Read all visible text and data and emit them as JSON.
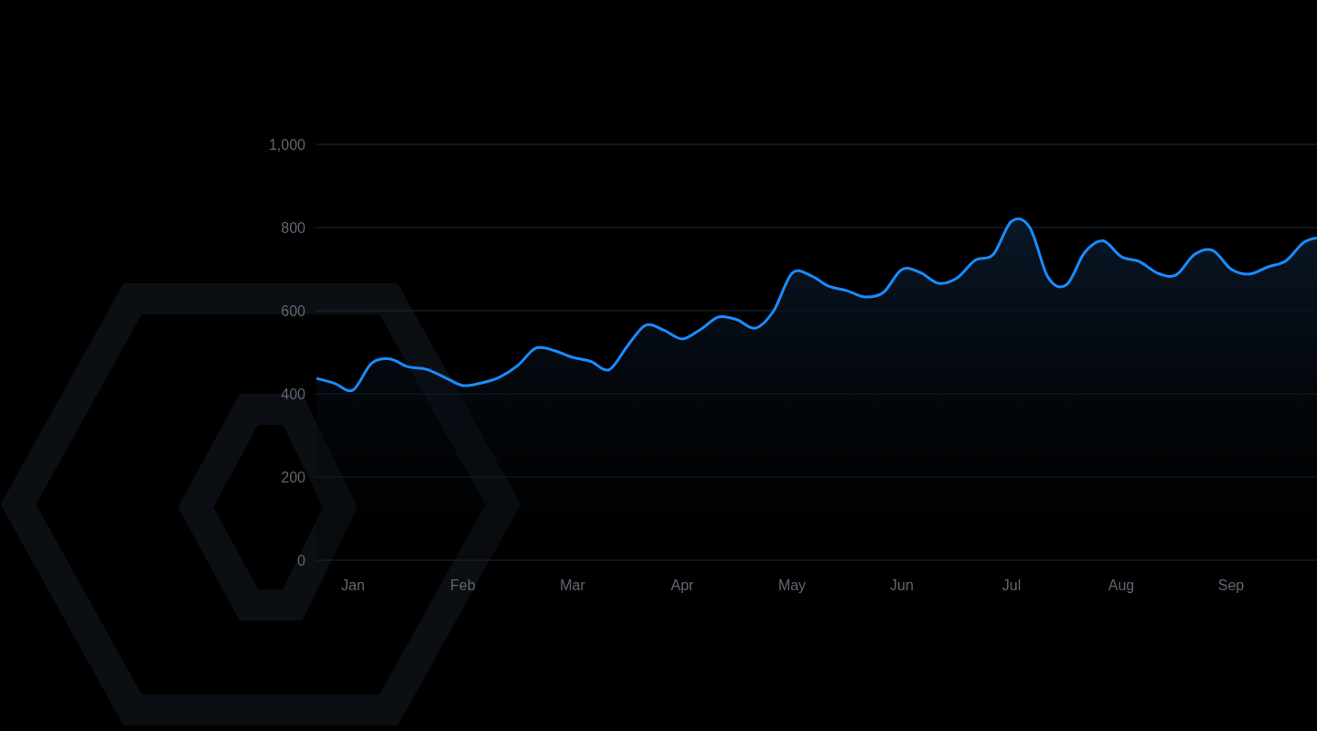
{
  "chart": {
    "chart_data": {
      "type": "area",
      "grid": true,
      "ylim": [
        0,
        1000
      ],
      "yticks": [
        0,
        200,
        400,
        600,
        800,
        {
          "value": 1000,
          "label": "1,000"
        }
      ],
      "categories": [
        null,
        null,
        "Jan",
        null,
        null,
        null,
        null,
        null,
        "Feb",
        null,
        null,
        null,
        null,
        null,
        "Mar",
        null,
        null,
        null,
        null,
        null,
        "Apr",
        null,
        null,
        null,
        null,
        null,
        "May",
        null,
        null,
        null,
        null,
        null,
        "Jun",
        null,
        null,
        null,
        null,
        null,
        "Jul",
        null,
        null,
        null,
        null,
        null,
        "Aug",
        null,
        null,
        null,
        null,
        null,
        "Sep",
        null,
        null,
        null,
        null,
        null
      ],
      "series": [
        {
          "color": "#1a8cff",
          "values": [
            437,
            425,
            409,
            473,
            484,
            465,
            459,
            440,
            420,
            426,
            440,
            468,
            510,
            504,
            488,
            478,
            458,
            515,
            565,
            553,
            532,
            555,
            585,
            578,
            558,
            600,
            690,
            685,
            659,
            648,
            633,
            644,
            699,
            692,
            666,
            678,
            721,
            735,
            815,
            800,
            680,
            662,
            740,
            768,
            730,
            718,
            690,
            686,
            735,
            745,
            700,
            688,
            705,
            720,
            765,
            778
          ]
        }
      ]
    }
  }
}
